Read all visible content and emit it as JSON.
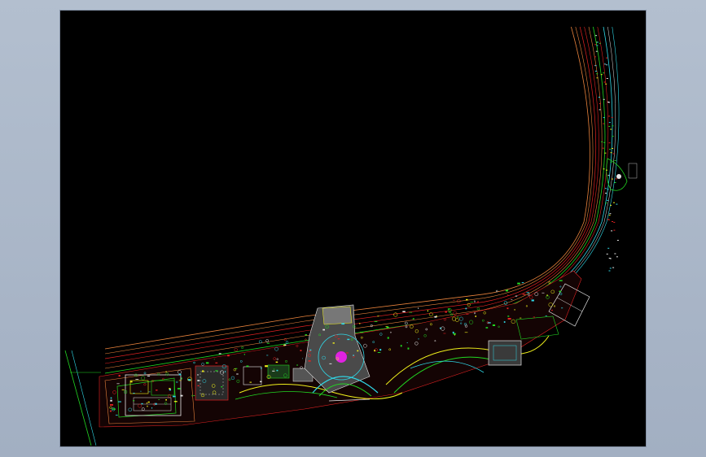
{
  "drawing": {
    "background": "#000000",
    "frame_color": "#a9b6c8",
    "colors": {
      "orange": "#e8823c",
      "red": "#e02222",
      "yellow": "#f2f21c",
      "green": "#22d622",
      "cyan": "#2fd7e6",
      "white": "#e6e6e6",
      "magenta": "#e022e0",
      "blue": "#4a6cf0"
    }
  }
}
